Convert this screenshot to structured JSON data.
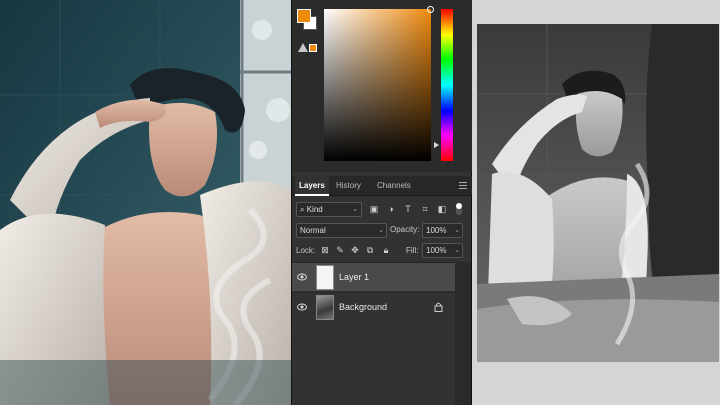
{
  "color_picker": {
    "foreground": "#f08a0e",
    "background": "#ffffff",
    "gamut_warning_icon": "warning-triangle-icon"
  },
  "panel_tabs": [
    {
      "label": "Layers",
      "active": true
    },
    {
      "label": "History",
      "active": false
    },
    {
      "label": "Channels",
      "active": false
    }
  ],
  "filter": {
    "kind_label": "Kind"
  },
  "blend": {
    "mode": "Normal",
    "opacity_label": "Opacity:",
    "opacity_value": "100%"
  },
  "lock": {
    "label": "Lock:",
    "fill_label": "Fill:",
    "fill_value": "100%"
  },
  "layers": [
    {
      "name": "Layer 1",
      "selected": true,
      "visible": true,
      "locked": false
    },
    {
      "name": "Background",
      "selected": false,
      "visible": true,
      "locked": true
    }
  ]
}
